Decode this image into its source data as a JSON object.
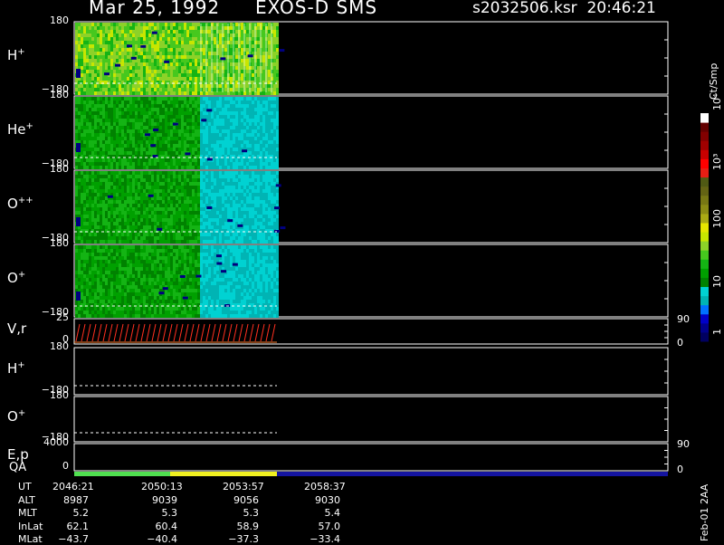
{
  "header": {
    "date": "Mar 25, 1992",
    "mission": "EXOS-D SMS",
    "file": "s2032506.ksr",
    "time": "20:46:21"
  },
  "colorbar": {
    "unit": "Ct/Smp",
    "labels": [
      "1",
      "10",
      "100",
      "10³",
      "10⁴"
    ],
    "colors": [
      "#000060",
      "#00008c",
      "#0000c8",
      "#0070ff",
      "#00b4b4",
      "#00d2d2",
      "#008200",
      "#00a000",
      "#14b414",
      "#46c81e",
      "#8cd228",
      "#c8e600",
      "#e6e600",
      "#aaaa14",
      "#8c8c14",
      "#787814",
      "#646414",
      "#505a14",
      "#e61e14",
      "#ff0000",
      "#c80000",
      "#a00000",
      "#820000",
      "#640000",
      "#ffffff"
    ]
  },
  "panels": [
    {
      "id": "h-plus",
      "label": "H",
      "sup": "+",
      "ytop": "180",
      "ybot": "−180"
    },
    {
      "id": "he-plus",
      "label": "He",
      "sup": "+",
      "ytop": "180",
      "ybot": "−180"
    },
    {
      "id": "o-plus-plus",
      "label": "O",
      "sup": "++",
      "ytop": "180",
      "ybot": "−180"
    },
    {
      "id": "o-plus",
      "label": "O",
      "sup": "+",
      "ytop": "180",
      "ybot": "−180"
    },
    {
      "id": "vr",
      "label": "V,r",
      "sup": "",
      "ytop": "25",
      "ybot": "0",
      "rtop": "90",
      "rbot": "0"
    },
    {
      "id": "h-plus-2",
      "label": "H",
      "sup": "+",
      "ytop": "180",
      "ybot": "−180"
    },
    {
      "id": "o-plus-2",
      "label": "O",
      "sup": "+",
      "ytop": "180",
      "ybot": "−180"
    },
    {
      "id": "ep",
      "label": "E,p",
      "sup": "",
      "ytop": "4000",
      "ybot": "0",
      "rtop": "90",
      "rbot": "0"
    }
  ],
  "qa_label": "QA",
  "qa_colors": [
    "#50e050",
    "#f0f020",
    "#1414a0"
  ],
  "table": {
    "row_labels": [
      "UT",
      "ALT",
      "MLT",
      "InLat",
      "MLat"
    ],
    "columns": [
      [
        "2046:21",
        "8987",
        "5.2",
        "62.1",
        "−43.7"
      ],
      [
        "2050:13",
        "9039",
        "5.3",
        "60.4",
        "−40.4"
      ],
      [
        "2053:57",
        "9056",
        "5.3",
        "58.9",
        "−37.3"
      ],
      [
        "2058:37",
        "9030",
        "5.4",
        "57.0",
        "−33.4"
      ]
    ]
  },
  "footer_note": "Feb-01 2AA",
  "chart_data": {
    "type": "heatmap",
    "title": "Mar 25, 1992   EXOS-D SMS",
    "x": [
      "2046:21",
      "2050:13",
      "2053:57",
      "2058:37"
    ],
    "xlabel": "UT",
    "species": [
      "H+",
      "He+",
      "O++",
      "O+"
    ],
    "ylim": [
      -180,
      180
    ],
    "colorscale_ticks": [
      1,
      10,
      100,
      1000,
      10000
    ],
    "colorscale_unit": "Ct/Smp",
    "dominant_level_by_species": {
      "H+": "~100",
      "He+": "~10-30",
      "O++": "~10-30",
      "O+": "~10-30"
    }
  }
}
